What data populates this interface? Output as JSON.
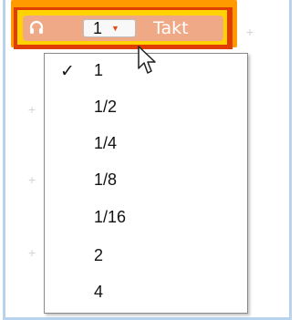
{
  "block": {
    "icon": "headphones-icon",
    "selected_value": "1",
    "dropdown_arrow_icon": "caret-down-icon",
    "label": "Takt",
    "colors": {
      "outer": "#ff9a00",
      "inner_red": "#e03d00",
      "inner_yellow": "#ffd200",
      "pill": "#f0a987",
      "arrow": "#e24a16"
    }
  },
  "menu": {
    "items": [
      {
        "label": "1",
        "checked": true,
        "check_mark": "✓"
      },
      {
        "label": "1/2",
        "checked": false
      },
      {
        "label": "1/4",
        "checked": false
      },
      {
        "label": "1/8",
        "checked": false
      },
      {
        "label": "1/16",
        "checked": false
      },
      {
        "label": "2",
        "checked": false
      },
      {
        "label": "4",
        "checked": false
      }
    ]
  },
  "cursor_icon": "arrow-cursor-icon",
  "grid_icon": "plus-icon"
}
